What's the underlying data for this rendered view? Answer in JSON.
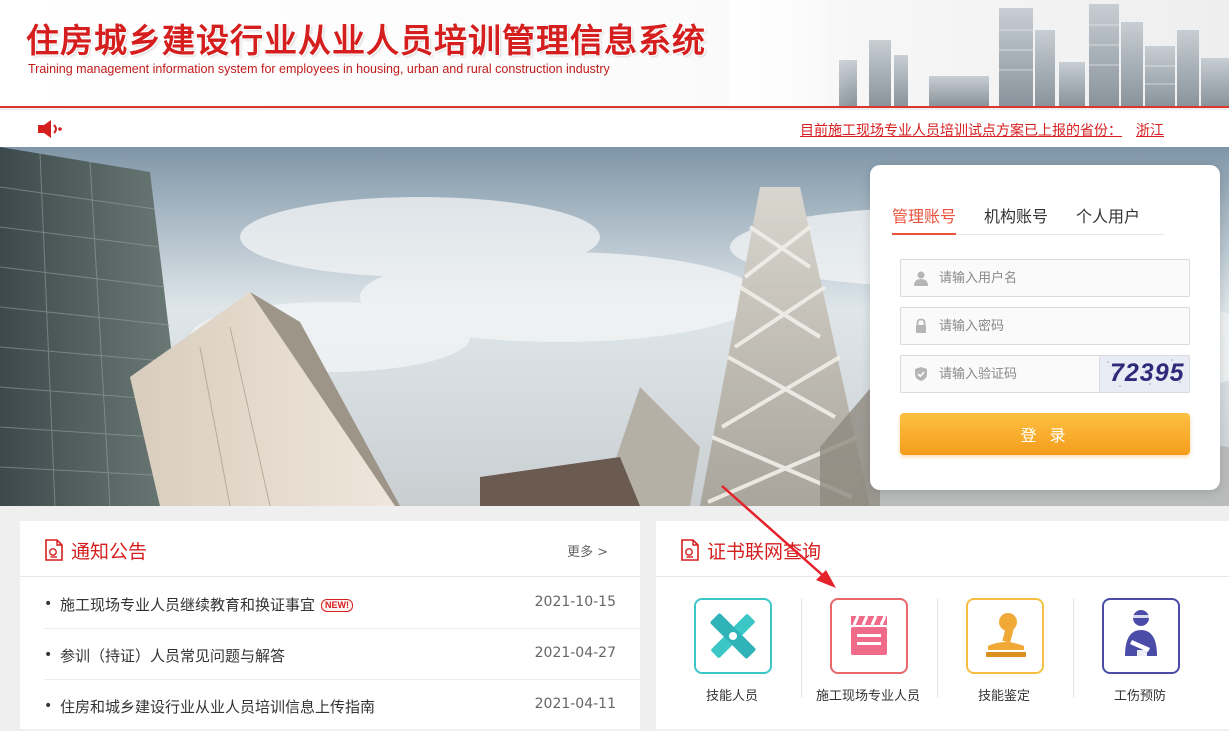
{
  "header": {
    "title_cn": "住房城乡建设行业从业人员培训管理信息系统",
    "title_en": "Training management information system for employees in housing, urban and rural construction industry"
  },
  "notice_bar": {
    "speaker_icon": "speaker-icon",
    "text": "目前施工现场专业人员培训试点方案已上报的省份：",
    "province": "浙江"
  },
  "login": {
    "tabs": [
      "管理账号",
      "机构账号",
      "个人用户"
    ],
    "active_tab": "管理账号",
    "username_placeholder": "请输入用户名",
    "password_placeholder": "请输入密码",
    "captcha_placeholder": "请输入验证码",
    "captcha_text": "72395",
    "submit_label": "登 录",
    "accent_color": "#e9523c",
    "button_color": "#f59c1c"
  },
  "notices": {
    "title": "通知公告",
    "more": "更多 >",
    "items": [
      {
        "title": "施工现场专业人员继续教育和换证事宜",
        "badge": "NEW!",
        "date": "2021-10-15"
      },
      {
        "title": "参训（持证）人员常见问题与解答",
        "date": "2021-04-27"
      },
      {
        "title": "住房和城乡建设行业从业人员培训信息上传指南",
        "date": "2021-04-11"
      }
    ]
  },
  "certificates": {
    "title": "证书联网查询",
    "items": [
      {
        "label": "技能人员",
        "icon": "tools-icon",
        "color": "#3cc7c7"
      },
      {
        "label": "施工现场专业人员",
        "icon": "clapperboard-icon",
        "color": "#e8676a"
      },
      {
        "label": "技能鉴定",
        "icon": "stamp-icon",
        "color": "#f5c042"
      },
      {
        "label": "工伤预防",
        "icon": "injured-worker-icon",
        "color": "#4b4ba8"
      }
    ]
  },
  "brand_color": "#d51f1f"
}
